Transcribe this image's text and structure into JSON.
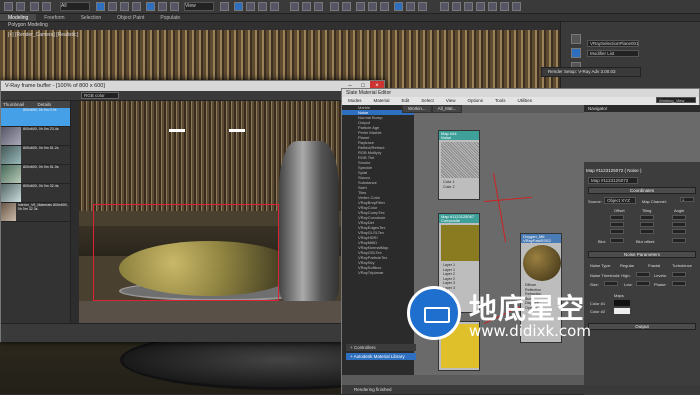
{
  "ribbon": {
    "dropdown_all": "All",
    "dropdown_view": "View"
  },
  "main_tabs": [
    "Modeling",
    "Freeform",
    "Selection",
    "Object Paint",
    "Populate"
  ],
  "sub_title": "Polygon Modeling",
  "viewport": {
    "label": "[+] [Render_Camera] [Realistic]"
  },
  "right_panel": {
    "modifier_list": "Modifier List",
    "object_name": "VRaySelectionPlane001"
  },
  "render_setup": {
    "title": "Render Setup: V-Ray Adv 3.00.03"
  },
  "vfb": {
    "title": "V-Ray frame buffer - [100% of 800 x 600]",
    "channel": "RGB color",
    "history": {
      "headers": [
        "Thumbnail",
        "Details"
      ],
      "rows": [
        {
          "text": "800x600, 0h 0m 0.0s",
          "selected": true
        },
        {
          "text": "800x600, 0h 0m 23.4s",
          "selected": false
        },
        {
          "text": "800x600, 0h 0m 51.2s",
          "selected": false
        },
        {
          "text": "800x600, 0h 0m 51.0s",
          "selected": false
        },
        {
          "text": "800x600, 0h 0m 32.4s",
          "selected": false
        },
        {
          "text": "Interior_V6_Materials 800x600, 0h 0m 32.3s",
          "selected": false
        }
      ]
    }
  },
  "slate": {
    "title": "Slate Material Editor",
    "menu": [
      "Modes",
      "Material",
      "Edit",
      "Select",
      "View",
      "Options",
      "Tools",
      "Utilities"
    ],
    "view_tabs": [
      "Workin...",
      "All_Mat..."
    ],
    "view_name": "Working_View",
    "navigator": "Navigator",
    "map_name": "Map #1123125072 ( Noise )",
    "map_field": "Map #1123125072",
    "coordinates_rollout": "Coordinates",
    "source_label": "Source:",
    "source_value": "Object XYZ",
    "map_channel_label": "Map Channel:",
    "map_channel_value": "1",
    "offset_label": "Offset",
    "tiling_label": "Tiling",
    "angle_label": "Angle",
    "blur_label": "Blur:",
    "blur_offset_label": "Blur offset:",
    "noise_rollout": "Noise Parameters",
    "noise_type_label": "Noise Type:",
    "noise_types": [
      "Regular",
      "Fractal",
      "Turbulence"
    ],
    "noise_threshold_label": "Noise Threshold: High:",
    "levels_label": "Levels:",
    "size_label": "Size:",
    "low_label": "Low:",
    "phase_label": "Phase:",
    "color1_label": "Color #1",
    "color2_label": "Color #2",
    "maps_label": "Maps",
    "output_rollout": "Output",
    "controllers": "+ Controllers",
    "autodesk_lib": "+ Autodesk Material Library",
    "status": "Rendering finished",
    "browser_items": [
      "Marble",
      "Noise",
      "Normal Bump",
      "Output",
      "Particle Age",
      "Perlin Marble",
      "Planet",
      "Raytrace",
      "Reflect/Refract",
      "RGB Multiply",
      "RGB Tint",
      "Smoke",
      "Speckle",
      "Splat",
      "Stucco",
      "Substance",
      "Swirl",
      "Tiles",
      "Vertex Color",
      "VRayBmpFilter",
      "VRayColor",
      "VRayCompTex",
      "VRayCurvature",
      "VRayDirt",
      "VRayEdgesTex",
      "VRayGLSLTex",
      "VRayHDRI",
      "VRayMtlID",
      "VRayNormalMap",
      "VRayOSLTex",
      "VRayParticleTex",
      "VRaySky",
      "VRaySoftbox",
      "VRayTriplanar"
    ],
    "nodes": {
      "noise": {
        "title": "Map #44",
        "subtitle": "Noise",
        "slots": [
          "Color 1",
          "Color 2"
        ]
      },
      "composite": {
        "title": "Map #1123125067",
        "subtitle": "Composite",
        "slots": [
          "Layer 1",
          "Layer 1",
          "Layer 2",
          "Layer 2",
          "Layer 3",
          "Layer 3"
        ]
      },
      "vray_mtl": {
        "title": "Oxygen_Mtl",
        "subtitle": "VRayFastSSS2",
        "slots": [
          "Diffuse",
          "Reflection",
          "Refraction",
          "Bump",
          "Displace",
          "Opacity"
        ]
      }
    }
  },
  "watermark": {
    "cn": "地底星空",
    "url": "www.didixk.com"
  }
}
